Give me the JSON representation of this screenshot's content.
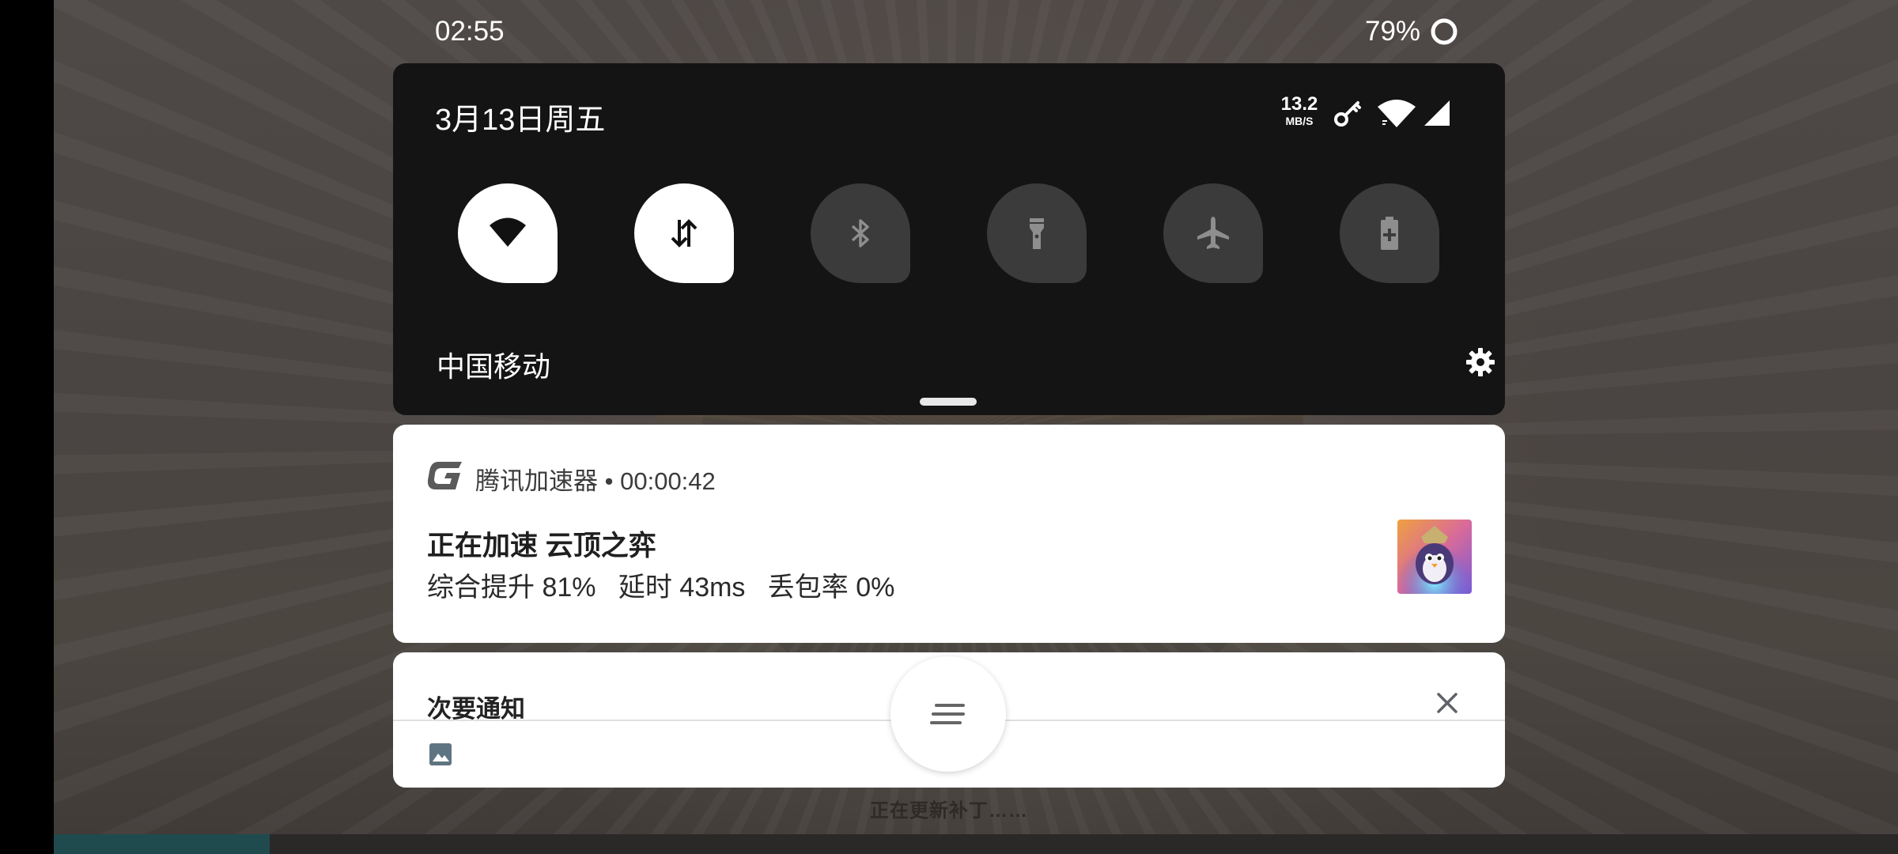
{
  "status_bar": {
    "time": "02:55",
    "battery": "79%"
  },
  "quick_settings": {
    "date": "3月13日周五",
    "net_speed_value": "13.2",
    "net_speed_unit": "MB/S",
    "carrier": "中国移动",
    "tiles": [
      {
        "name": "wifi",
        "icon": "wifi-icon",
        "state": "on"
      },
      {
        "name": "mobile-data",
        "icon": "data-transfer-icon",
        "state": "on"
      },
      {
        "name": "bluetooth",
        "icon": "bluetooth-icon",
        "state": "off"
      },
      {
        "name": "flashlight",
        "icon": "flashlight-icon",
        "state": "off"
      },
      {
        "name": "airplane-mode",
        "icon": "airplane-icon",
        "state": "off"
      },
      {
        "name": "battery-saver",
        "icon": "battery-saver-icon",
        "state": "off"
      }
    ]
  },
  "notification": {
    "app": "腾讯加速器",
    "separator": "•",
    "elapsed": "00:00:42",
    "title": "正在加速 云顶之弈",
    "stats": "综合提升 81%   延时 43ms   丢包率 0%"
  },
  "minor_notifications": {
    "title": "次要通知"
  },
  "background": {
    "loading_text": "正在更新补丁……",
    "progress_fraction": 0.117
  },
  "colors": {
    "panel": "#141414",
    "tile_on": "#ffffff",
    "tile_off": "#3b3b3b",
    "progress": "#1f4b4f"
  }
}
